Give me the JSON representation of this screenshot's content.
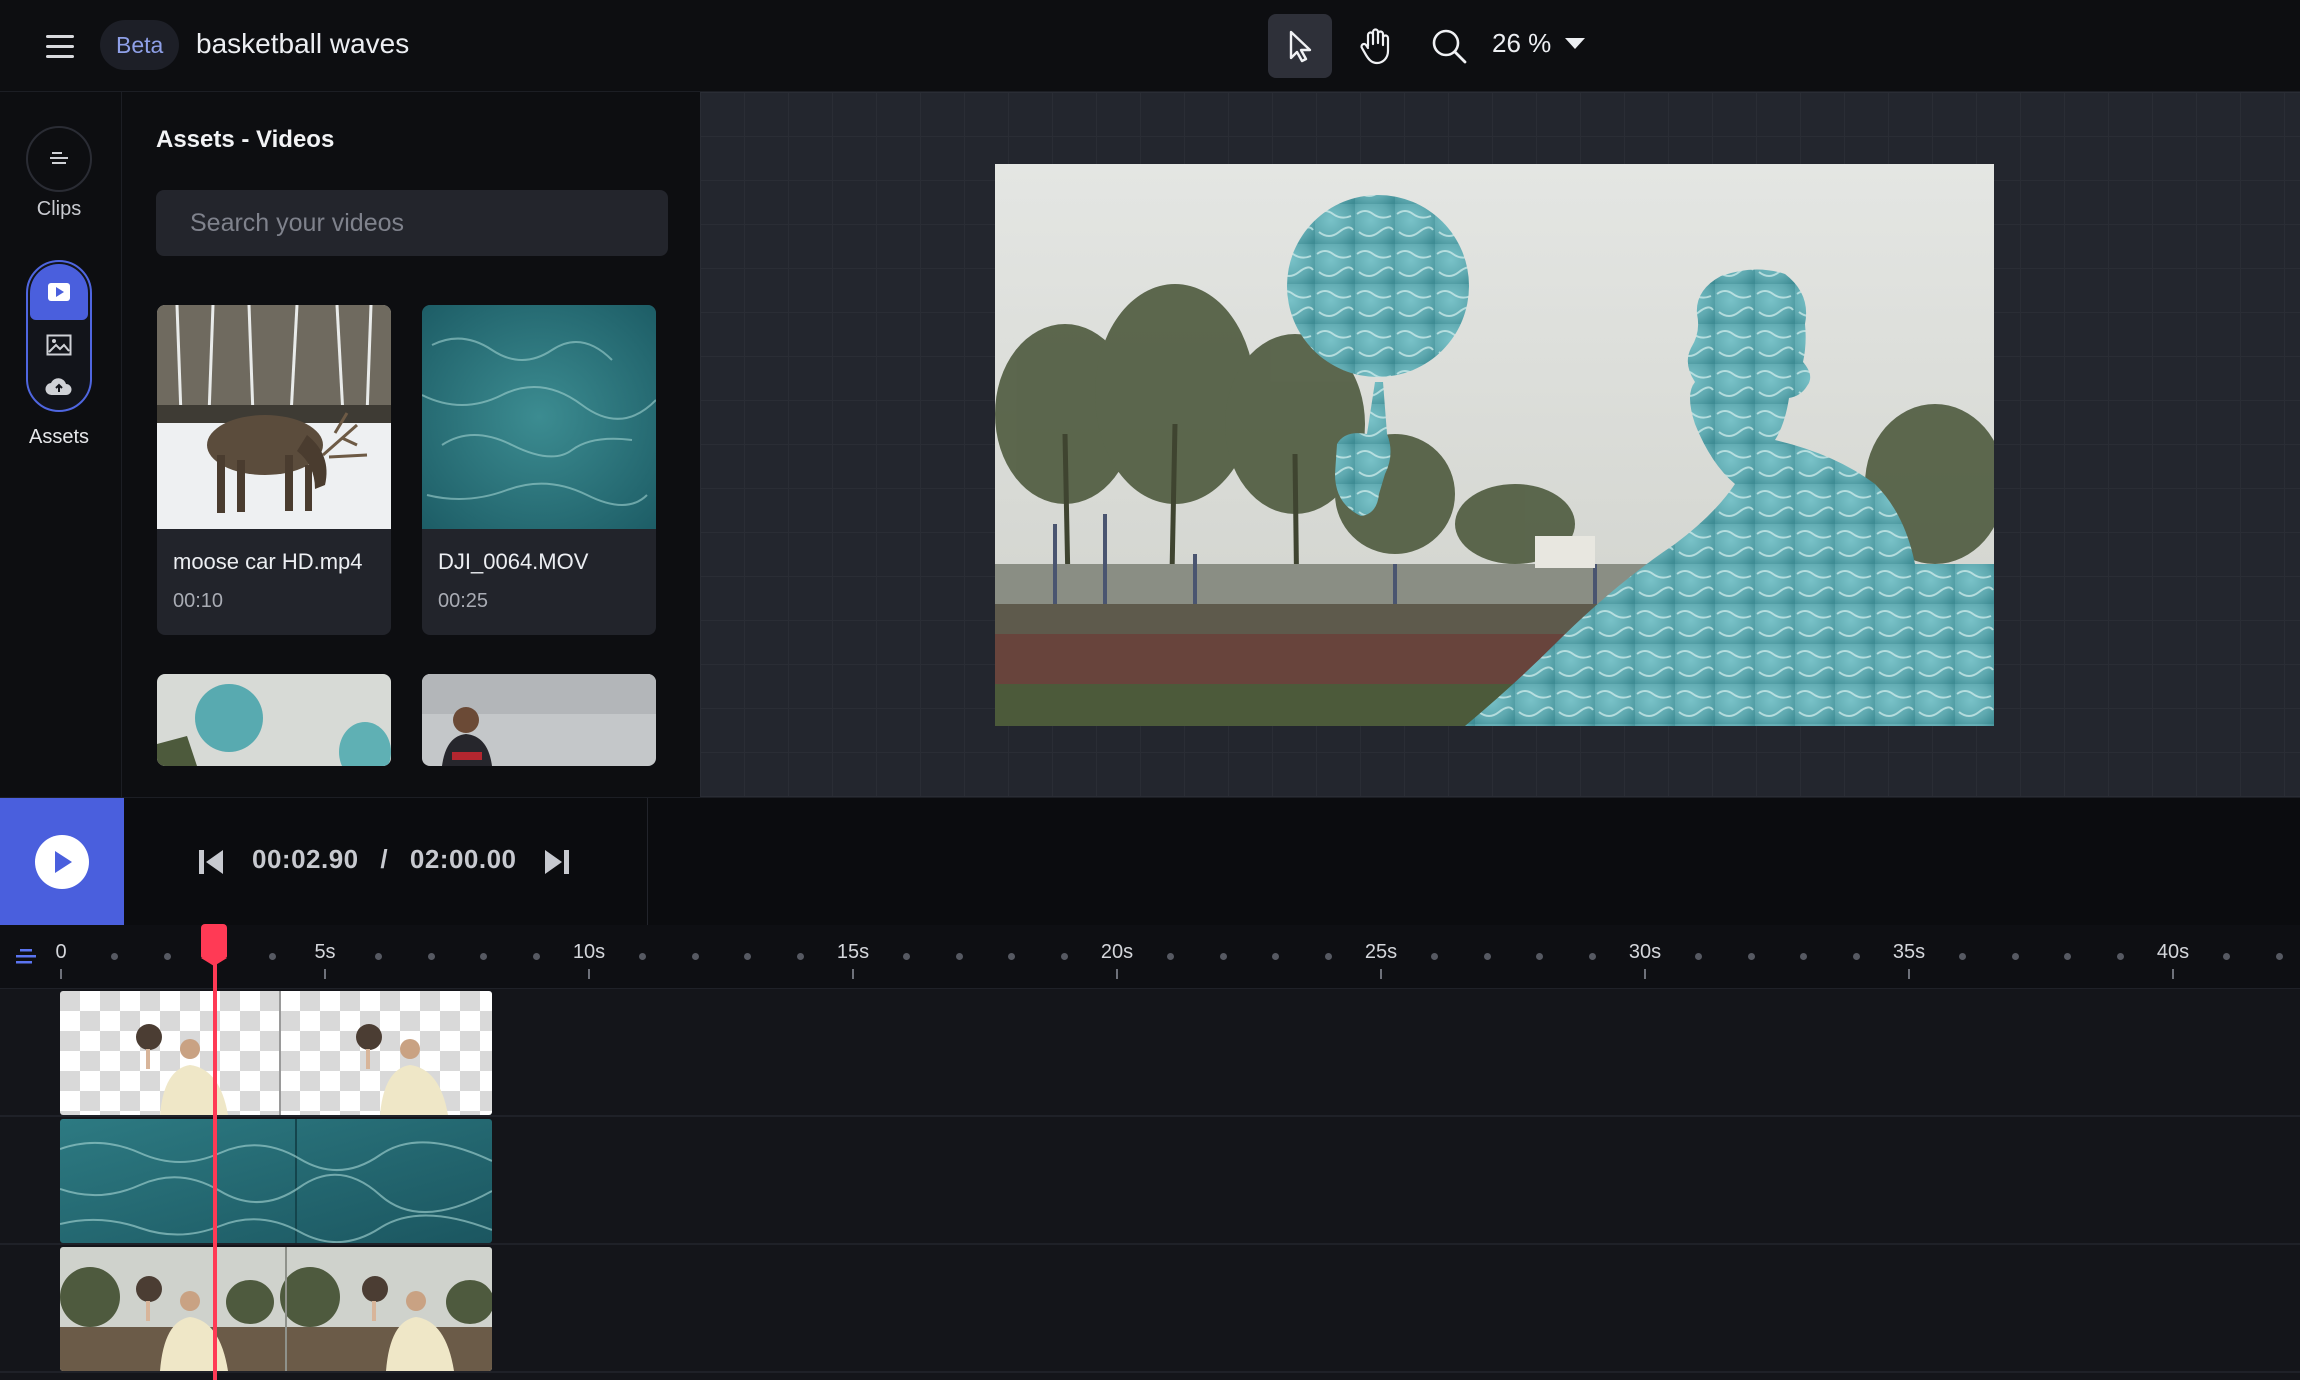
{
  "header": {
    "menu_icon": "hamburger-menu-icon",
    "badge": "Beta",
    "project_title": "basketball waves",
    "tools": [
      "pointer-select-icon",
      "hand-pan-icon",
      "magnifier-zoom-icon"
    ],
    "zoom_label": "26 %"
  },
  "rail": {
    "clips_label": "Clips",
    "assets_label": "Assets",
    "asset_icons": [
      "video-play-icon",
      "image-icon",
      "cloud-upload-icon"
    ],
    "accent": "#4a5fdd"
  },
  "assets": {
    "title": "Assets - Videos",
    "search_placeholder": "Search your videos",
    "items": [
      {
        "name": "moose car HD.mp4",
        "duration": "00:10"
      },
      {
        "name": "DJI_0064.MOV",
        "duration": "00:25"
      }
    ]
  },
  "transport": {
    "current_time": "00:02.90",
    "separator": "/",
    "total_time": "02:00.00"
  },
  "ruler": {
    "labels": [
      "0",
      "5s",
      "10s",
      "15s",
      "20s",
      "25s",
      "30s",
      "35s",
      "40s"
    ]
  },
  "playhead": {
    "time_s": 2.9,
    "color": "#ff3a55"
  }
}
